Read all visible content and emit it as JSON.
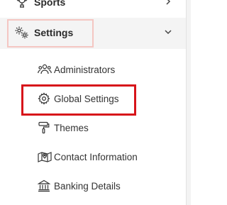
{
  "sidebar": {
    "sports": {
      "label": "Sports",
      "icon": "trophy-icon"
    },
    "settings": {
      "label": "Settings",
      "icon": "gears-icon",
      "expanded": true
    },
    "sub_items": [
      {
        "label": "Administrators",
        "icon": "users-icon"
      },
      {
        "label": "Global Settings",
        "icon": "gear-icon"
      },
      {
        "label": "Themes",
        "icon": "paint-roller-icon"
      },
      {
        "label": "Contact Information",
        "icon": "map-pin-icon"
      },
      {
        "label": "Banking Details",
        "icon": "bank-icon"
      }
    ]
  },
  "colors": {
    "highlight_red": "#d7141a",
    "settings_outline": "#f4c6c2",
    "active_background": "#f4f4f4"
  }
}
